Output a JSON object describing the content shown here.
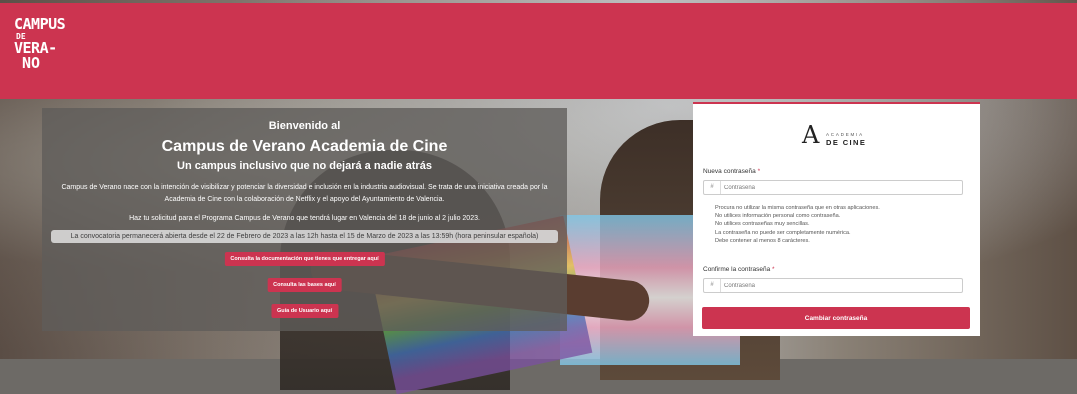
{
  "header": {
    "logo": {
      "line1": "CAMPUS",
      "line2": "DE",
      "line3": "VERA-",
      "line4": "NO"
    },
    "color": "#cc3450"
  },
  "info": {
    "welcome": "Bienvenido al",
    "title": "Campus de Verano Academia de Cine",
    "subtitle": "Un campus inclusivo que no dejará a nadie atrás",
    "description": "Campus de Verano nace con la intención de visibilizar y potenciar la diversidad e inclusión en la industria audiovisual. Se trata de una iniciativa creada por la Academia de Cine con la colaboración de Netflix y el apoyo del Ayuntamiento de Valencia.",
    "apply": "Haz tu solicitud para el Programa Campus de Verano que tendrá lugar en Valencia del 18 de junio al 2 julio 2023.",
    "deadline": "La convocatoria permanecerá abierta desde el 22 de Febrero de 2023 a las 12h hasta el 15 de Marzo de 2023 a las 13:59h (hora peninsular española)",
    "buttons": {
      "docs": "Consulta la documentación que tienes que entregar aquí",
      "rules": "Consulta las bases aquí",
      "guide": "Guía de Usuario aquí"
    }
  },
  "form": {
    "brand": {
      "small": "ACADEMIA",
      "big": "DE CINE",
      "mark": "A"
    },
    "new_password": {
      "label": "Nueva contraseña",
      "required": "*",
      "placeholder": "Contraseña",
      "prefix": "#"
    },
    "rules": [
      "Procura no utilizar la misma contraseña que en otras aplicaciones.",
      "No utilices información personal como contraseña.",
      "No utilices contraseñas muy sencillas.",
      "La contraseña no puede ser completamente numérica.",
      "Debe contener al menos 8 carácteres."
    ],
    "confirm_password": {
      "label": "Confirme la contraseña",
      "required": "*",
      "placeholder": "Contraseña",
      "prefix": "#"
    },
    "submit": "Cambiar contraseña"
  }
}
